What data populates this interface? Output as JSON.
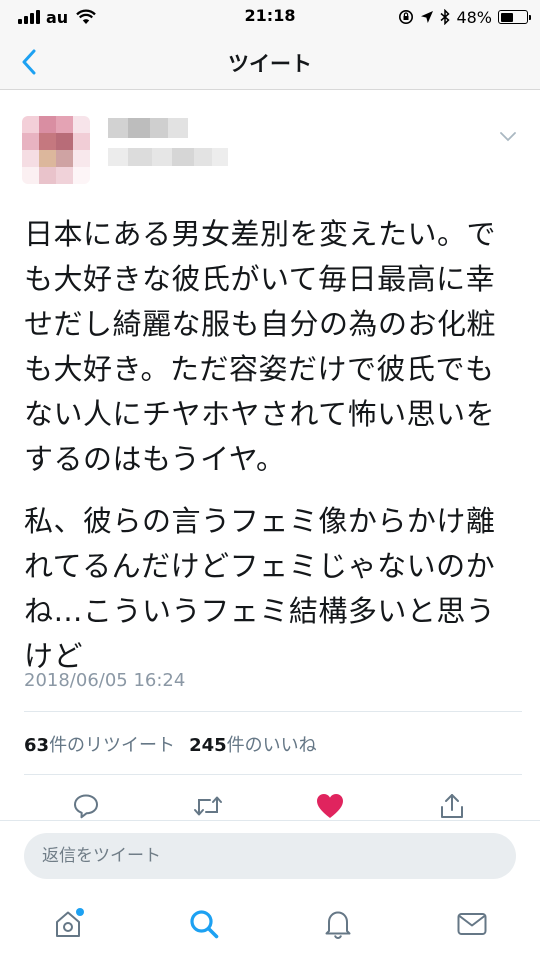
{
  "status_bar": {
    "carrier": "au",
    "time": "21:18",
    "battery_percent": "48%",
    "battery_level": 0.48
  },
  "nav": {
    "title": "ツイート",
    "back_icon": "chevron-left-icon"
  },
  "tweet": {
    "paragraphs": [
      "日本にある男女差別を変えたい。でも大好きな彼氏がいて毎日最高に幸せだし綺麗な服も自分の為のお化粧も大好き。ただ容姿だけで彼氏でもない人にチヤホヤされて怖い思いをするのはもうイヤ。",
      "私、彼らの言うフェミ像からかけ離れてるんだけどフェミじゃないのかね…こういうフェミ結構多いと思うけど"
    ],
    "timestamp": "2018/06/05 16:24",
    "retweets": {
      "count": "63",
      "label": "件のリツイート"
    },
    "likes": {
      "count": "245",
      "label": "件のいいね"
    }
  },
  "actions": [
    {
      "icon": "reply-icon"
    },
    {
      "icon": "retweet-icon"
    },
    {
      "icon": "heart-icon",
      "active": true
    },
    {
      "icon": "share-icon"
    }
  ],
  "reply": {
    "placeholder": "返信をツイート"
  },
  "tabs": [
    {
      "icon": "home-icon",
      "notification_dot": true
    },
    {
      "icon": "search-icon",
      "active": true
    },
    {
      "icon": "notifications-icon"
    },
    {
      "icon": "messages-icon"
    }
  ],
  "colors": {
    "accent": "#1da1f2",
    "like": "#e0245e",
    "icon_gray": "#657786",
    "text": "#14171a",
    "secondary": "#8b98a5"
  }
}
